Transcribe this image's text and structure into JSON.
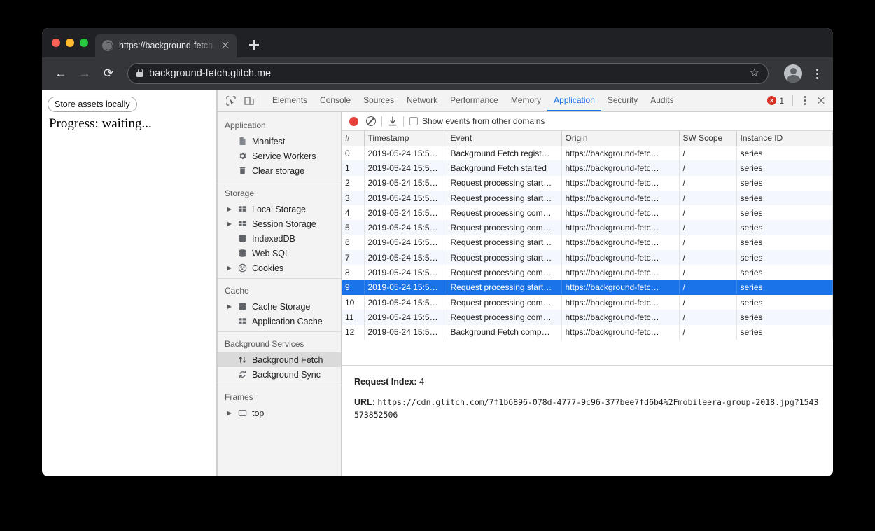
{
  "browser": {
    "tab": {
      "title": "https://background-fetch.glitch",
      "favicon": "globe-icon",
      "close": "×"
    },
    "newtab_label": "+",
    "nav": {
      "back": "←",
      "forward": "→",
      "reload": "⟳"
    },
    "omnibox": {
      "url": "background-fetch.glitch.me",
      "lock": "lock-icon",
      "star": "☆"
    },
    "profile": "avatar-icon",
    "menu": "kebab-menu-icon"
  },
  "page": {
    "store_button": "Store assets locally",
    "progress": "Progress: waiting..."
  },
  "devtools": {
    "inspect_icon": "cursor-inspect-icon",
    "device_icon": "device-toggle-icon",
    "tabs": [
      {
        "label": "Elements",
        "active": false
      },
      {
        "label": "Console",
        "active": false
      },
      {
        "label": "Sources",
        "active": false
      },
      {
        "label": "Network",
        "active": false
      },
      {
        "label": "Performance",
        "active": false
      },
      {
        "label": "Memory",
        "active": false
      },
      {
        "label": "Application",
        "active": true
      },
      {
        "label": "Security",
        "active": false
      },
      {
        "label": "Audits",
        "active": false
      }
    ],
    "error_count": "1",
    "accent": "#1a73e8",
    "error_color": "#d93025",
    "record_color": "#e8413a",
    "sidebar": [
      {
        "title": "Application",
        "items": [
          {
            "label": "Manifest",
            "icon": "document-icon",
            "arrow": false,
            "selected": false
          },
          {
            "label": "Service Workers",
            "icon": "gear-icon",
            "arrow": false,
            "selected": false
          },
          {
            "label": "Clear storage",
            "icon": "trash-icon",
            "arrow": false,
            "selected": false
          }
        ]
      },
      {
        "title": "Storage",
        "items": [
          {
            "label": "Local Storage",
            "icon": "table-icon",
            "arrow": true,
            "selected": false
          },
          {
            "label": "Session Storage",
            "icon": "table-icon",
            "arrow": true,
            "selected": false
          },
          {
            "label": "IndexedDB",
            "icon": "database-icon",
            "arrow": false,
            "selected": false
          },
          {
            "label": "Web SQL",
            "icon": "database-icon",
            "arrow": false,
            "selected": false
          },
          {
            "label": "Cookies",
            "icon": "cookie-icon",
            "arrow": true,
            "selected": false
          }
        ]
      },
      {
        "title": "Cache",
        "items": [
          {
            "label": "Cache Storage",
            "icon": "database-icon",
            "arrow": true,
            "selected": false
          },
          {
            "label": "Application Cache",
            "icon": "table-icon",
            "arrow": false,
            "selected": false
          }
        ]
      },
      {
        "title": "Background Services",
        "items": [
          {
            "label": "Background Fetch",
            "icon": "up-down-arrows-icon",
            "arrow": false,
            "selected": true
          },
          {
            "label": "Background Sync",
            "icon": "sync-icon",
            "arrow": false,
            "selected": false
          }
        ]
      },
      {
        "title": "Frames",
        "items": [
          {
            "label": "top",
            "icon": "frame-icon",
            "arrow": true,
            "selected": false
          }
        ]
      }
    ],
    "record_toolbar": {
      "record_icon": "record-circle-icon",
      "clear_icon": "clear-ban-icon",
      "download_icon": "download-icon",
      "checkbox_checked": false,
      "checkbox_label": "Show events from other domains"
    },
    "table": {
      "columns": [
        "#",
        "Timestamp",
        "Event",
        "Origin",
        "SW Scope",
        "Instance ID"
      ],
      "rows": [
        {
          "n": "0",
          "timestamp": "2019-05-24 15:5…",
          "event": "Background Fetch regist…",
          "origin": "https://background-fetc…",
          "scope": "/",
          "instance": "series",
          "selected": false
        },
        {
          "n": "1",
          "timestamp": "2019-05-24 15:5…",
          "event": "Background Fetch started",
          "origin": "https://background-fetc…",
          "scope": "/",
          "instance": "series",
          "selected": false
        },
        {
          "n": "2",
          "timestamp": "2019-05-24 15:5…",
          "event": "Request processing start…",
          "origin": "https://background-fetc…",
          "scope": "/",
          "instance": "series",
          "selected": false
        },
        {
          "n": "3",
          "timestamp": "2019-05-24 15:5…",
          "event": "Request processing start…",
          "origin": "https://background-fetc…",
          "scope": "/",
          "instance": "series",
          "selected": false
        },
        {
          "n": "4",
          "timestamp": "2019-05-24 15:5…",
          "event": "Request processing com…",
          "origin": "https://background-fetc…",
          "scope": "/",
          "instance": "series",
          "selected": false
        },
        {
          "n": "5",
          "timestamp": "2019-05-24 15:5…",
          "event": "Request processing com…",
          "origin": "https://background-fetc…",
          "scope": "/",
          "instance": "series",
          "selected": false
        },
        {
          "n": "6",
          "timestamp": "2019-05-24 15:5…",
          "event": "Request processing start…",
          "origin": "https://background-fetc…",
          "scope": "/",
          "instance": "series",
          "selected": false
        },
        {
          "n": "7",
          "timestamp": "2019-05-24 15:5…",
          "event": "Request processing start…",
          "origin": "https://background-fetc…",
          "scope": "/",
          "instance": "series",
          "selected": false
        },
        {
          "n": "8",
          "timestamp": "2019-05-24 15:5…",
          "event": "Request processing com…",
          "origin": "https://background-fetc…",
          "scope": "/",
          "instance": "series",
          "selected": false
        },
        {
          "n": "9",
          "timestamp": "2019-05-24 15:5…",
          "event": "Request processing start…",
          "origin": "https://background-fetc…",
          "scope": "/",
          "instance": "series",
          "selected": true
        },
        {
          "n": "10",
          "timestamp": "2019-05-24 15:5…",
          "event": "Request processing com…",
          "origin": "https://background-fetc…",
          "scope": "/",
          "instance": "series",
          "selected": false
        },
        {
          "n": "11",
          "timestamp": "2019-05-24 15:5…",
          "event": "Request processing com…",
          "origin": "https://background-fetc…",
          "scope": "/",
          "instance": "series",
          "selected": false
        },
        {
          "n": "12",
          "timestamp": "2019-05-24 15:5…",
          "event": "Background Fetch comp…",
          "origin": "https://background-fetc…",
          "scope": "/",
          "instance": "series",
          "selected": false
        }
      ]
    },
    "detail": {
      "request_index_label": "Request Index:",
      "request_index_value": "4",
      "url_label": "URL:",
      "url_value": "https://cdn.glitch.com/7f1b6896-078d-4777-9c96-377bee7fd6b4%2Fmobileera-group-2018.jpg?1543573852506"
    }
  }
}
